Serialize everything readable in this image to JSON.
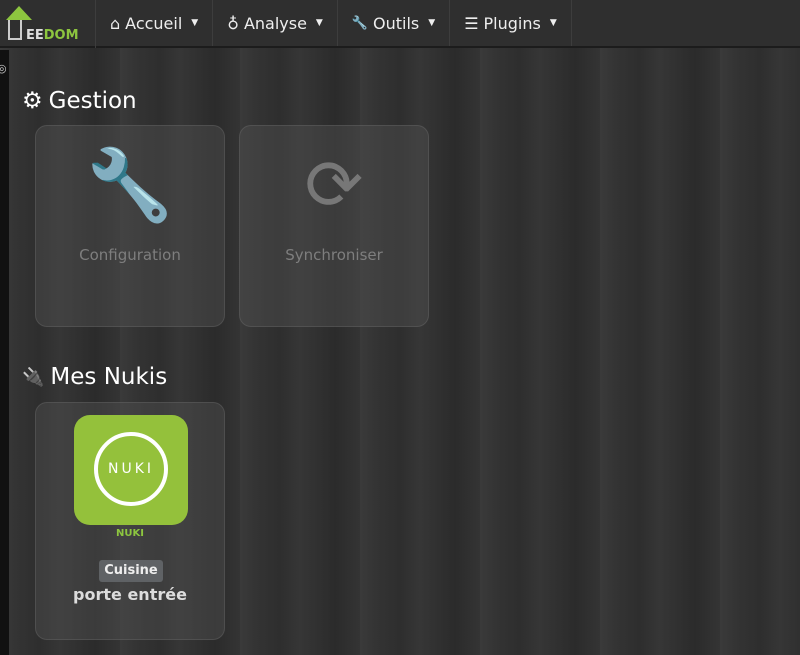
{
  "nav": {
    "logo": "JEEDOM",
    "logo_a": "EE",
    "logo_b": "DOM",
    "items": [
      {
        "icon": "⌂",
        "label": "Accueil"
      },
      {
        "icon": "♁",
        "label": "Analyse"
      },
      {
        "icon": "🔧",
        "label": "Outils"
      },
      {
        "icon": "☰",
        "label": "Plugins"
      }
    ]
  },
  "gestion": {
    "title": "Gestion",
    "cards": [
      {
        "label": "Configuration"
      },
      {
        "label": "Synchroniser"
      }
    ]
  },
  "nukis": {
    "title": "Mes Nukis",
    "devices": [
      {
        "logo_text": "NUKI",
        "plugin_label": "NUKI",
        "room": "Cuisine",
        "name": "porte entrée"
      }
    ]
  }
}
